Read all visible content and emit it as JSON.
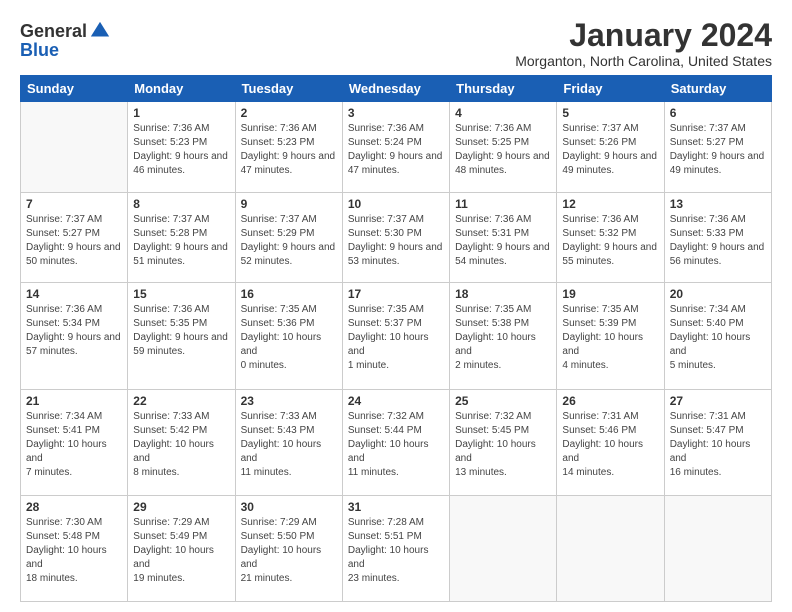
{
  "logo": {
    "general": "General",
    "blue": "Blue"
  },
  "header": {
    "month": "January 2024",
    "location": "Morganton, North Carolina, United States"
  },
  "weekdays": [
    "Sunday",
    "Monday",
    "Tuesday",
    "Wednesday",
    "Thursday",
    "Friday",
    "Saturday"
  ],
  "weeks": [
    [
      {
        "day": "",
        "sunrise": "",
        "sunset": "",
        "daylight": ""
      },
      {
        "day": "1",
        "sunrise": "Sunrise: 7:36 AM",
        "sunset": "Sunset: 5:23 PM",
        "daylight": "Daylight: 9 hours and 46 minutes."
      },
      {
        "day": "2",
        "sunrise": "Sunrise: 7:36 AM",
        "sunset": "Sunset: 5:23 PM",
        "daylight": "Daylight: 9 hours and 47 minutes."
      },
      {
        "day": "3",
        "sunrise": "Sunrise: 7:36 AM",
        "sunset": "Sunset: 5:24 PM",
        "daylight": "Daylight: 9 hours and 47 minutes."
      },
      {
        "day": "4",
        "sunrise": "Sunrise: 7:36 AM",
        "sunset": "Sunset: 5:25 PM",
        "daylight": "Daylight: 9 hours and 48 minutes."
      },
      {
        "day": "5",
        "sunrise": "Sunrise: 7:37 AM",
        "sunset": "Sunset: 5:26 PM",
        "daylight": "Daylight: 9 hours and 49 minutes."
      },
      {
        "day": "6",
        "sunrise": "Sunrise: 7:37 AM",
        "sunset": "Sunset: 5:27 PM",
        "daylight": "Daylight: 9 hours and 49 minutes."
      }
    ],
    [
      {
        "day": "7",
        "sunrise": "Sunrise: 7:37 AM",
        "sunset": "Sunset: 5:27 PM",
        "daylight": "Daylight: 9 hours and 50 minutes."
      },
      {
        "day": "8",
        "sunrise": "Sunrise: 7:37 AM",
        "sunset": "Sunset: 5:28 PM",
        "daylight": "Daylight: 9 hours and 51 minutes."
      },
      {
        "day": "9",
        "sunrise": "Sunrise: 7:37 AM",
        "sunset": "Sunset: 5:29 PM",
        "daylight": "Daylight: 9 hours and 52 minutes."
      },
      {
        "day": "10",
        "sunrise": "Sunrise: 7:37 AM",
        "sunset": "Sunset: 5:30 PM",
        "daylight": "Daylight: 9 hours and 53 minutes."
      },
      {
        "day": "11",
        "sunrise": "Sunrise: 7:36 AM",
        "sunset": "Sunset: 5:31 PM",
        "daylight": "Daylight: 9 hours and 54 minutes."
      },
      {
        "day": "12",
        "sunrise": "Sunrise: 7:36 AM",
        "sunset": "Sunset: 5:32 PM",
        "daylight": "Daylight: 9 hours and 55 minutes."
      },
      {
        "day": "13",
        "sunrise": "Sunrise: 7:36 AM",
        "sunset": "Sunset: 5:33 PM",
        "daylight": "Daylight: 9 hours and 56 minutes."
      }
    ],
    [
      {
        "day": "14",
        "sunrise": "Sunrise: 7:36 AM",
        "sunset": "Sunset: 5:34 PM",
        "daylight": "Daylight: 9 hours and 57 minutes."
      },
      {
        "day": "15",
        "sunrise": "Sunrise: 7:36 AM",
        "sunset": "Sunset: 5:35 PM",
        "daylight": "Daylight: 9 hours and 59 minutes."
      },
      {
        "day": "16",
        "sunrise": "Sunrise: 7:35 AM",
        "sunset": "Sunset: 5:36 PM",
        "daylight": "Daylight: 10 hours and 0 minutes."
      },
      {
        "day": "17",
        "sunrise": "Sunrise: 7:35 AM",
        "sunset": "Sunset: 5:37 PM",
        "daylight": "Daylight: 10 hours and 1 minute."
      },
      {
        "day": "18",
        "sunrise": "Sunrise: 7:35 AM",
        "sunset": "Sunset: 5:38 PM",
        "daylight": "Daylight: 10 hours and 2 minutes."
      },
      {
        "day": "19",
        "sunrise": "Sunrise: 7:35 AM",
        "sunset": "Sunset: 5:39 PM",
        "daylight": "Daylight: 10 hours and 4 minutes."
      },
      {
        "day": "20",
        "sunrise": "Sunrise: 7:34 AM",
        "sunset": "Sunset: 5:40 PM",
        "daylight": "Daylight: 10 hours and 5 minutes."
      }
    ],
    [
      {
        "day": "21",
        "sunrise": "Sunrise: 7:34 AM",
        "sunset": "Sunset: 5:41 PM",
        "daylight": "Daylight: 10 hours and 7 minutes."
      },
      {
        "day": "22",
        "sunrise": "Sunrise: 7:33 AM",
        "sunset": "Sunset: 5:42 PM",
        "daylight": "Daylight: 10 hours and 8 minutes."
      },
      {
        "day": "23",
        "sunrise": "Sunrise: 7:33 AM",
        "sunset": "Sunset: 5:43 PM",
        "daylight": "Daylight: 10 hours and 11 minutes."
      },
      {
        "day": "24",
        "sunrise": "Sunrise: 7:32 AM",
        "sunset": "Sunset: 5:44 PM",
        "daylight": "Daylight: 10 hours and 11 minutes."
      },
      {
        "day": "25",
        "sunrise": "Sunrise: 7:32 AM",
        "sunset": "Sunset: 5:45 PM",
        "daylight": "Daylight: 10 hours and 13 minutes."
      },
      {
        "day": "26",
        "sunrise": "Sunrise: 7:31 AM",
        "sunset": "Sunset: 5:46 PM",
        "daylight": "Daylight: 10 hours and 14 minutes."
      },
      {
        "day": "27",
        "sunrise": "Sunrise: 7:31 AM",
        "sunset": "Sunset: 5:47 PM",
        "daylight": "Daylight: 10 hours and 16 minutes."
      }
    ],
    [
      {
        "day": "28",
        "sunrise": "Sunrise: 7:30 AM",
        "sunset": "Sunset: 5:48 PM",
        "daylight": "Daylight: 10 hours and 18 minutes."
      },
      {
        "day": "29",
        "sunrise": "Sunrise: 7:29 AM",
        "sunset": "Sunset: 5:49 PM",
        "daylight": "Daylight: 10 hours and 19 minutes."
      },
      {
        "day": "30",
        "sunrise": "Sunrise: 7:29 AM",
        "sunset": "Sunset: 5:50 PM",
        "daylight": "Daylight: 10 hours and 21 minutes."
      },
      {
        "day": "31",
        "sunrise": "Sunrise: 7:28 AM",
        "sunset": "Sunset: 5:51 PM",
        "daylight": "Daylight: 10 hours and 23 minutes."
      },
      {
        "day": "",
        "sunrise": "",
        "sunset": "",
        "daylight": ""
      },
      {
        "day": "",
        "sunrise": "",
        "sunset": "",
        "daylight": ""
      },
      {
        "day": "",
        "sunrise": "",
        "sunset": "",
        "daylight": ""
      }
    ]
  ]
}
